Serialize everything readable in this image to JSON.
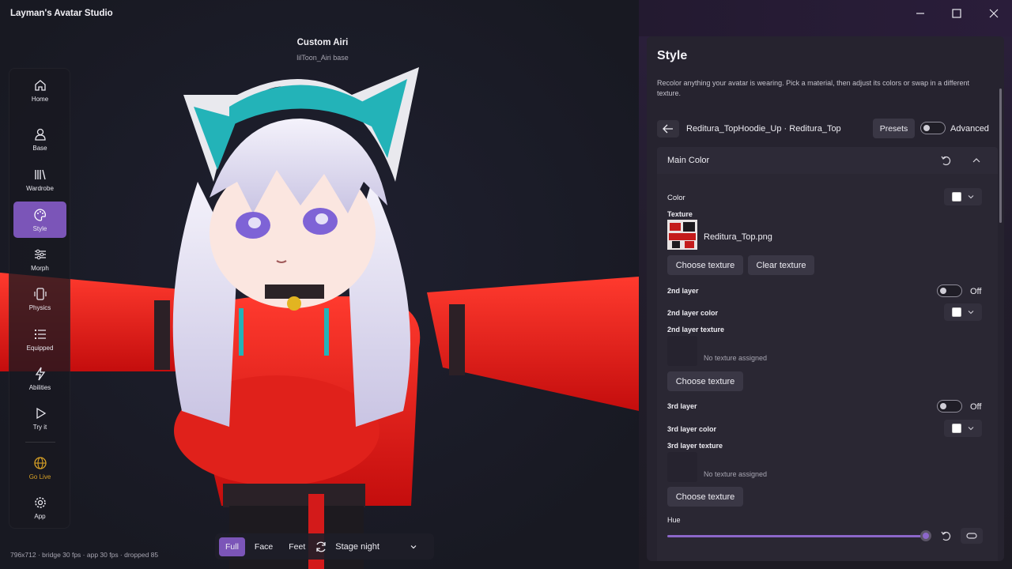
{
  "app": {
    "title": "Layman's Avatar Studio"
  },
  "viewport": {
    "avatar_name": "Custom Airi",
    "avatar_base": "lilToon_Airi base",
    "status": "796x712 · bridge 30 fps · app 30 fps · dropped 85",
    "view_modes": [
      "Full",
      "Face",
      "Feet"
    ],
    "active_view": "Full",
    "stage": "Stage night"
  },
  "sidebar": {
    "items": [
      {
        "label": "Home",
        "icon": "home-icon"
      },
      {
        "label": "Base",
        "icon": "person-icon"
      },
      {
        "label": "Wardrobe",
        "icon": "wardrobe-icon"
      },
      {
        "label": "Style",
        "icon": "palette-icon",
        "active": true
      },
      {
        "label": "Morph",
        "icon": "sliders-icon"
      },
      {
        "label": "Physics",
        "icon": "phone-vibrate-icon"
      },
      {
        "label": "Equipped",
        "icon": "list-icon"
      },
      {
        "label": "Abilities",
        "icon": "lightning-icon"
      },
      {
        "label": "Try it",
        "icon": "play-icon"
      },
      {
        "label": "Go Live",
        "icon": "globe-icon"
      },
      {
        "label": "App",
        "icon": "gear-icon"
      }
    ]
  },
  "panel": {
    "title": "Style",
    "description": "Recolor anything your avatar is wearing. Pick a material, then adjust its colors or swap in a different texture.",
    "breadcrumb": "Reditura_TopHoodie_Up · Reditura_Top",
    "presets_label": "Presets",
    "advanced_label": "Advanced",
    "section": {
      "title": "Main Color",
      "color_label": "Color",
      "color_value": "#ffffff",
      "texture_label": "Texture",
      "texture_file": "Reditura_Top.png",
      "choose_texture": "Choose texture",
      "clear_texture": "Clear texture",
      "layer2": {
        "label": "2nd layer",
        "state": "Off",
        "color_label": "2nd layer color",
        "texture_label": "2nd layer texture",
        "empty_text": "No texture assigned",
        "choose_texture": "Choose texture"
      },
      "layer3": {
        "label": "3rd layer",
        "state": "Off",
        "color_label": "3rd layer color",
        "texture_label": "3rd layer texture",
        "empty_text": "No texture assigned",
        "choose_texture": "Choose texture"
      },
      "hue": {
        "label": "Hue",
        "value": 1.0
      }
    }
  },
  "colors": {
    "accent": "#7b55b8",
    "golive": "#d8a126"
  }
}
